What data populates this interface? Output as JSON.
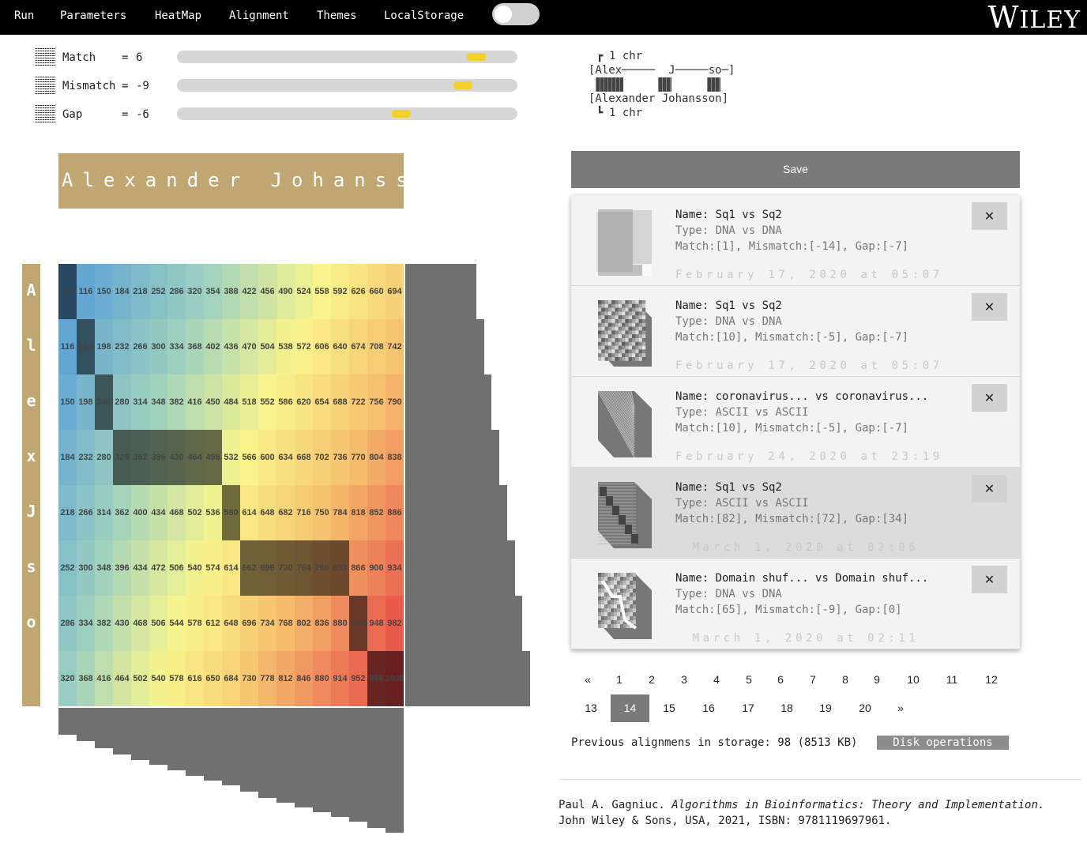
{
  "menu": {
    "items": [
      "Run",
      "Parameters",
      "HeatMap",
      "Alignment",
      "Themes",
      "LocalStorage"
    ],
    "theme_toggle_on": false
  },
  "brand": {
    "first": "W",
    "rest": "ILEY"
  },
  "parameters": [
    {
      "label": "Match",
      "eq": "=",
      "value": "6",
      "slider_fraction": 0.88
    },
    {
      "label": "Mismatch",
      "eq": "=",
      "value": "-9",
      "slider_fraction": 0.84
    },
    {
      "label": "Gap",
      "eq": "=",
      "value": "-6",
      "slider_fraction": 0.66
    }
  ],
  "preview": {
    "top_count": "1 chr",
    "top_seq": "[Alex─────  J─────so─]",
    "bottom_seq": "[Alexander Johansson]",
    "bottom_count": "1 chr",
    "brace_top": "┏",
    "brace_bottom": "┗"
  },
  "banner": {
    "sequence": "Alexander Johansson"
  },
  "heatmap": {
    "row_letters": [
      "A",
      "l",
      "e",
      "x",
      "J",
      "s",
      "o"
    ],
    "values": [
      [
        82,
        116,
        150,
        184,
        218,
        252,
        286,
        320,
        354,
        388,
        422,
        456,
        490,
        524,
        558,
        592,
        626,
        660,
        694
      ],
      [
        116,
        164,
        198,
        232,
        266,
        300,
        334,
        368,
        402,
        436,
        470,
        504,
        538,
        572,
        606,
        640,
        674,
        708,
        742
      ],
      [
        150,
        198,
        246,
        280,
        314,
        348,
        382,
        416,
        450,
        484,
        518,
        552,
        586,
        620,
        654,
        688,
        722,
        756,
        790
      ],
      [
        184,
        232,
        280,
        328,
        362,
        396,
        430,
        464,
        498,
        532,
        566,
        600,
        634,
        668,
        702,
        736,
        770,
        804,
        838
      ],
      [
        218,
        266,
        314,
        362,
        400,
        434,
        468,
        502,
        536,
        580,
        614,
        648,
        682,
        716,
        750,
        784,
        818,
        852,
        886
      ],
      [
        252,
        300,
        348,
        396,
        434,
        472,
        506,
        540,
        574,
        614,
        662,
        696,
        730,
        764,
        798,
        832,
        866,
        900,
        934
      ],
      [
        286,
        334,
        382,
        430,
        468,
        506,
        544,
        578,
        612,
        648,
        696,
        734,
        768,
        802,
        836,
        880,
        914,
        948,
        982
      ],
      [
        320,
        368,
        416,
        464,
        502,
        540,
        578,
        616,
        650,
        684,
        730,
        778,
        812,
        846,
        880,
        914,
        952,
        996,
        1030
      ]
    ],
    "path": [
      [
        0,
        0
      ],
      [
        1,
        1
      ],
      [
        2,
        2
      ],
      [
        3,
        3
      ],
      [
        3,
        4
      ],
      [
        3,
        5
      ],
      [
        3,
        6
      ],
      [
        3,
        7
      ],
      [
        3,
        8
      ],
      [
        4,
        9
      ],
      [
        5,
        10
      ],
      [
        5,
        11
      ],
      [
        5,
        12
      ],
      [
        5,
        13
      ],
      [
        5,
        14
      ],
      [
        5,
        15
      ],
      [
        6,
        16
      ],
      [
        7,
        17
      ],
      [
        7,
        18
      ]
    ]
  },
  "save": {
    "label": "Save"
  },
  "saved_alignments": [
    {
      "name": "Name: Sq1 vs Sq2",
      "type": "Type: DNA vs DNA",
      "scores": "Match:[1], Mismatch:[-14], Gap:[-7]",
      "date": "February 17, 2020 at 05:07",
      "close": "✕",
      "selected": false,
      "thumb": "grid"
    },
    {
      "name": "Name: Sq1 vs Sq2",
      "type": "Type: DNA vs DNA",
      "scores": "Match:[10], Mismatch:[-5], Gap:[-7]",
      "date": "February 17, 2020 at 05:07",
      "close": "✕",
      "selected": false,
      "thumb": "noise"
    },
    {
      "name": "Name: coronavirus... vs coronavirus...",
      "type": "Type: ASCII vs ASCII",
      "scores": "Match:[10], Mismatch:[-5], Gap:[-7]",
      "date": "February 24, 2020 at 23:19",
      "close": "✕",
      "selected": false,
      "thumb": "gradient"
    },
    {
      "name": "Name: Sq1 vs Sq2",
      "type": "Type: ASCII vs ASCII",
      "scores": "Match:[82], Mismatch:[72], Gap:[34]",
      "date": "March 1, 2020 at 02:06",
      "close": "✕",
      "selected": true,
      "thumb": "diagonal"
    },
    {
      "name": "Name: Domain shuf... vs Domain shuf...",
      "type": "Type: DNA vs DNA",
      "scores": "Match:[65], Mismatch:[-9], Gap:[0]",
      "date": "March 1, 2020 at 02:11",
      "close": "✕",
      "selected": false,
      "thumb": "blocks"
    }
  ],
  "pagination": {
    "row1": [
      "«",
      "1",
      "2",
      "3",
      "4",
      "5",
      "6",
      "7",
      "8",
      "9",
      "10",
      "11",
      "12"
    ],
    "row2": [
      "13",
      "14",
      "15",
      "16",
      "17",
      "18",
      "19",
      "20",
      "»"
    ],
    "active": "14"
  },
  "storage": {
    "text": "Previous alignmens in storage: 98 (8513 KB)",
    "button": "Disk operations"
  },
  "citation": {
    "author": "Paul A. Gagniuc.",
    "title": "Algorithms in Bioinformatics: Theory and Implementation.",
    "publisher": "John Wiley & Sons, USA, 2021, ISBN: 9781119697961."
  }
}
